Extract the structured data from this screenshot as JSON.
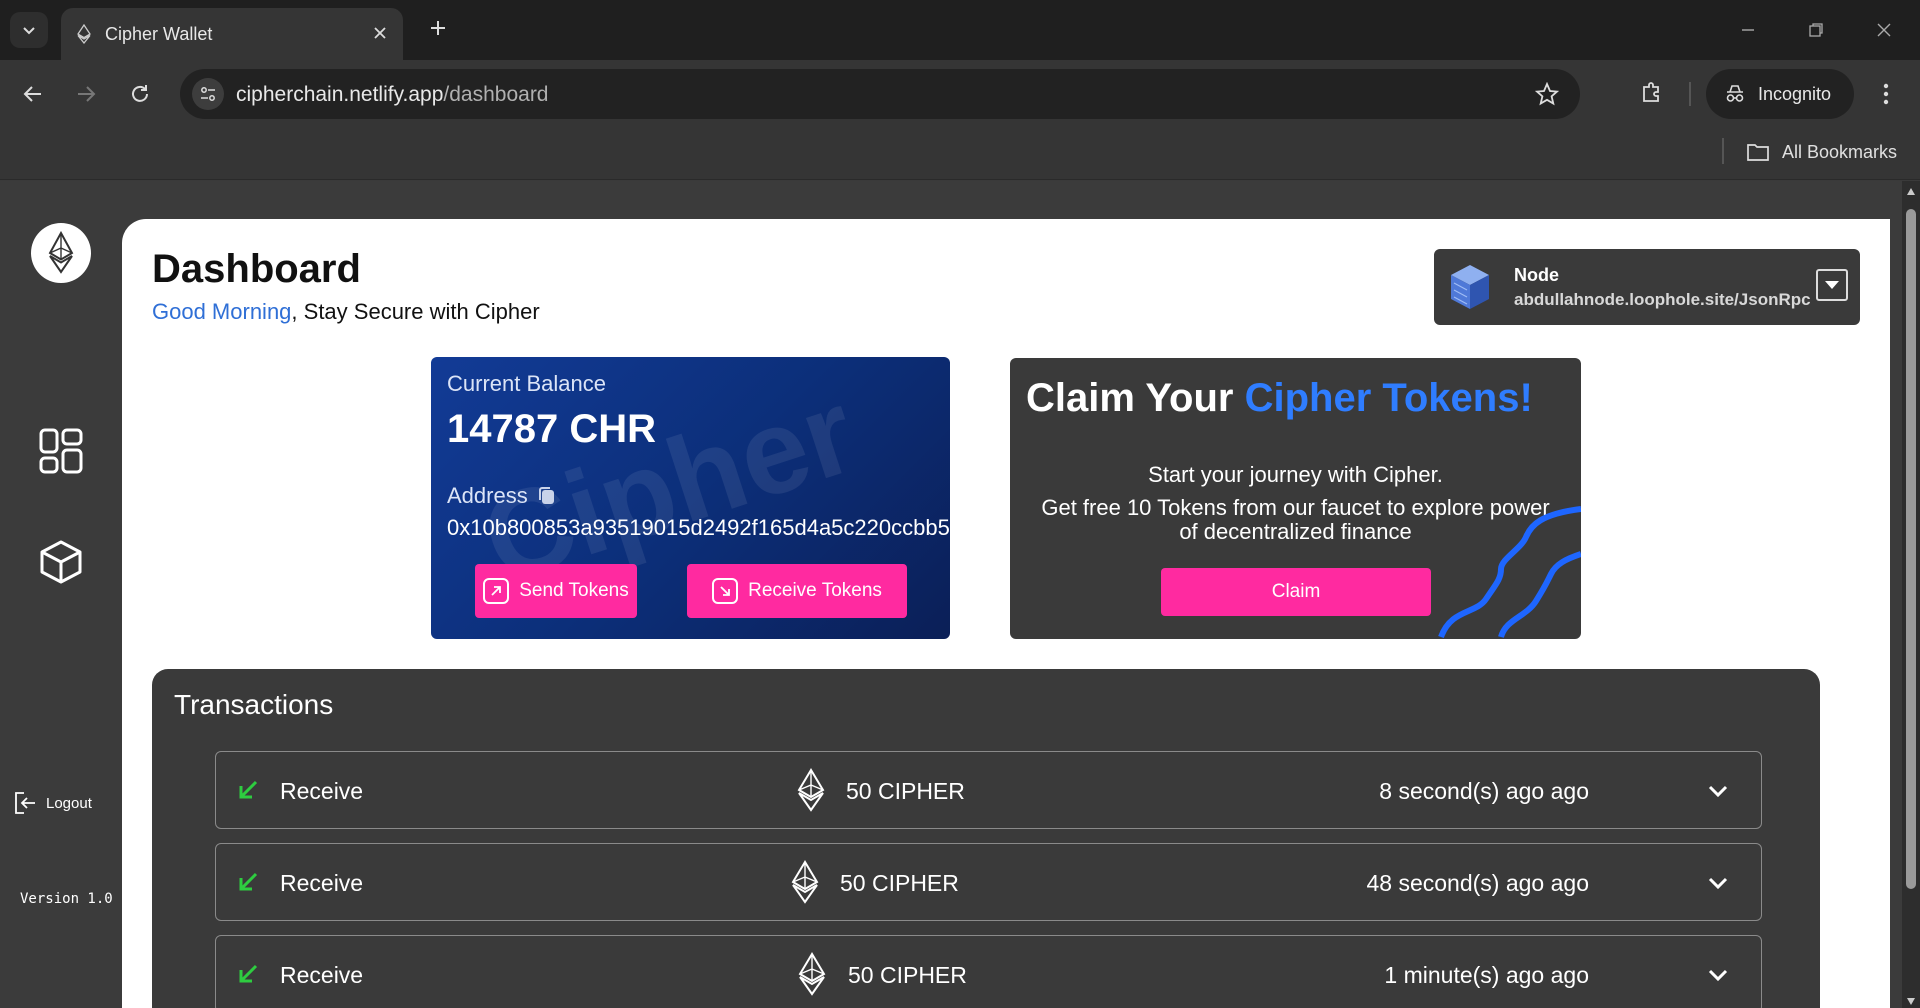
{
  "browser": {
    "tab_title": "Cipher Wallet",
    "url_host": "cipherchain.netlify.app",
    "url_path": "/dashboard",
    "incognito_label": "Incognito",
    "bookmarks_label": "All Bookmarks"
  },
  "sidebar": {
    "logout_label": "Logout",
    "version_label": "Version 1.0"
  },
  "header": {
    "title": "Dashboard",
    "greeting_accent": "Good Morning",
    "greeting_rest": ", Stay Secure with Cipher"
  },
  "node": {
    "label": "Node",
    "url": "abdullahnode.loophole.site/JsonRpc"
  },
  "balance": {
    "label": "Current Balance",
    "value": "14787 CHR",
    "watermark": "Cipher",
    "address_label": "Address",
    "address": "0x10b800853a93519015d2492f165d4a5c220ccbb5",
    "send_label": "Send Tokens",
    "receive_label": "Receive Tokens"
  },
  "claim": {
    "title_plain": "Claim Your ",
    "title_accent": "Cipher Tokens!",
    "line1": "Start your journey with Cipher.",
    "line2": "Get free 10 Tokens from our faucet to explore power of decentralized finance",
    "button": "Claim"
  },
  "transactions": {
    "title": "Transactions",
    "rows": [
      {
        "type": "Receive",
        "amount": "50 CIPHER",
        "time": "8 second(s) ago ago"
      },
      {
        "type": "Receive",
        "amount": "50 CIPHER",
        "time": "48 second(s) ago ago"
      },
      {
        "type": "Receive",
        "amount": "50 CIPHER",
        "time": "1 minute(s) ago ago"
      }
    ]
  },
  "colors": {
    "accent_blue": "#2f6fd6",
    "pink": "#ff2aa0",
    "receive_green": "#2ecc40",
    "card_blue": "#123b96"
  }
}
